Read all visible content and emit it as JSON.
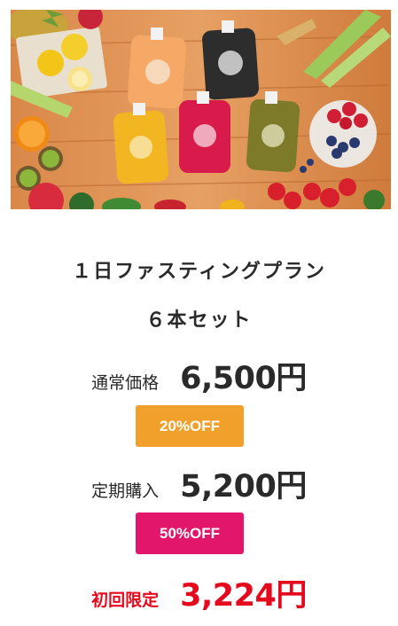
{
  "product": {
    "title_line1": "１日ファスティングプラン",
    "title_line2": "６本セット"
  },
  "pricing": {
    "regular": {
      "label": "通常価格",
      "price": "6,500円"
    },
    "discount1": {
      "badge": "20%OFF",
      "color": "#f0a02b"
    },
    "subscription": {
      "label": "定期購入",
      "price": "5,200円"
    },
    "discount2": {
      "badge": "50%OFF",
      "color": "#e2176b"
    },
    "first_time": {
      "label": "初回限定",
      "price": "3,224円",
      "color": "#e5091d"
    }
  },
  "hero_image": {
    "subject": "juice-pouches-with-fruits-and-vegetables"
  }
}
